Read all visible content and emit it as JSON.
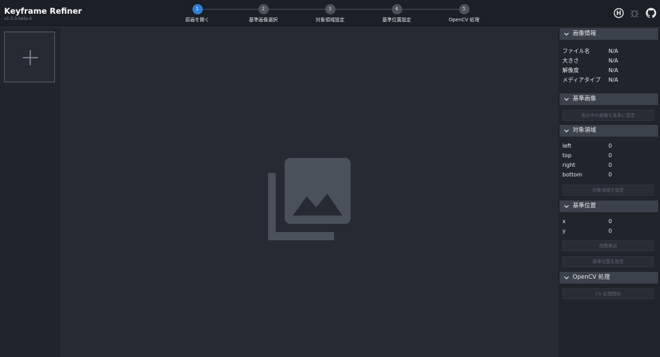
{
  "app": {
    "title": "Keyframe Refiner",
    "version": "v1.0.0-beta.4"
  },
  "steps": [
    {
      "number": "1",
      "label": "原画を開く",
      "active": true
    },
    {
      "number": "2",
      "label": "基準画像選択",
      "active": false
    },
    {
      "number": "3",
      "label": "対象領域設定",
      "active": false
    },
    {
      "number": "4",
      "label": "基準位置設定",
      "active": false
    },
    {
      "number": "5",
      "label": "OpenCV 処理",
      "active": false
    }
  ],
  "header_icons": [
    "help-circle-icon",
    "bug-icon",
    "github-icon"
  ],
  "thumbnails": {
    "add_icon": "plus-icon"
  },
  "canvas": {
    "placeholder_icon": "image-placeholder-icon"
  },
  "panel": {
    "image_info": {
      "title": "画像情報",
      "rows": [
        {
          "key": "ファイル名",
          "value": "N/A"
        },
        {
          "key": "大きさ",
          "value": "N/A"
        },
        {
          "key": "解像度",
          "value": "N/A"
        },
        {
          "key": "メディアタイプ",
          "value": "N/A"
        }
      ]
    },
    "base_image": {
      "title": "基準画像",
      "button": "表示中の画像を基準に設定"
    },
    "target_area": {
      "title": "対象領域",
      "rows": [
        {
          "key": "left",
          "value": "0"
        },
        {
          "key": "top",
          "value": "0"
        },
        {
          "key": "right",
          "value": "0"
        },
        {
          "key": "bottom",
          "value": "0"
        }
      ],
      "button": "対象領域を設定"
    },
    "base_position": {
      "title": "基準位置",
      "rows": [
        {
          "key": "x",
          "value": "0"
        },
        {
          "key": "y",
          "value": "0"
        }
      ],
      "auto_button": "自動算出",
      "set_button": "基準位置を設定"
    },
    "opencv": {
      "title": "OpenCV 処理",
      "button": "CV 処理開始"
    }
  },
  "colors": {
    "accent": "#2f7fd4",
    "background": "#232830",
    "header": "#1b1f26",
    "section_header": "#3c424b",
    "disabled_text": "#5d646e"
  }
}
